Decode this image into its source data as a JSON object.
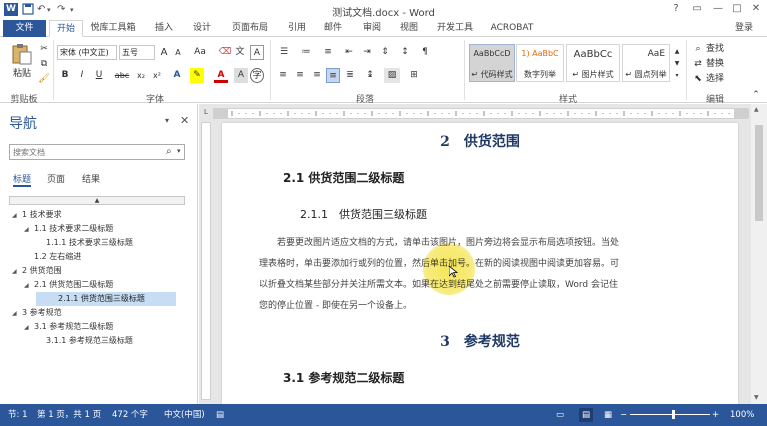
{
  "window": {
    "title": "测试文档.docx - Word",
    "app_icon": "W",
    "controls": [
      "?",
      "▭",
      "—",
      "□",
      "✕"
    ]
  },
  "qat": {
    "save_icon": "save-icon",
    "undo": "↶",
    "redo": "↷"
  },
  "tabs": [
    {
      "label": "文件",
      "active": false
    },
    {
      "label": "开始",
      "active": true
    },
    {
      "label": "悦库工具箱",
      "active": false
    },
    {
      "label": "插入",
      "active": false
    },
    {
      "label": "设计",
      "active": false
    },
    {
      "label": "页面布局",
      "active": false
    },
    {
      "label": "引用",
      "active": false
    },
    {
      "label": "邮件",
      "active": false
    },
    {
      "label": "审阅",
      "active": false
    },
    {
      "label": "视图",
      "active": false
    },
    {
      "label": "开发工具",
      "active": false
    },
    {
      "label": "ACROBAT",
      "active": false
    }
  ],
  "login": "登录",
  "ribbon": {
    "clipboard": {
      "paste": "粘贴",
      "label": "剪贴板"
    },
    "font": {
      "name": "宋体 (中文正)",
      "size": "五号",
      "label": "字体",
      "buttons": [
        "B",
        "I",
        "U",
        "abc",
        "x₂",
        "x²"
      ],
      "grow": "A",
      "shrink": "A",
      "aa": "Aa"
    },
    "paragraph": {
      "label": "段落"
    },
    "styles": {
      "label": "样式",
      "items": [
        {
          "preview": "AaBbCcD",
          "name": "↵ 代码样式"
        },
        {
          "preview": "1) AaBbC",
          "name": "数字列举"
        },
        {
          "preview": "AaBbCc",
          "name": "↵ 图片样式"
        },
        {
          "preview": "AaE",
          "name": "↵ 圆点列举"
        }
      ]
    },
    "editing": {
      "label": "编辑",
      "find": "查找",
      "replace": "替换",
      "select": "选择"
    }
  },
  "nav": {
    "title": "导航",
    "search_placeholder": "搜索文档",
    "tabs": [
      "标题",
      "页面",
      "结果"
    ],
    "tree": [
      {
        "level": 1,
        "text": "1 技术要求",
        "expanded": true,
        "selected": false
      },
      {
        "level": 2,
        "text": "1.1 技术要求二级标题",
        "expanded": true,
        "selected": false
      },
      {
        "level": 3,
        "text": "1.1.1 技术要求三级标题",
        "expanded": false,
        "selected": false
      },
      {
        "level": 2,
        "text": "1.2 左右缩进",
        "expanded": false,
        "selected": false
      },
      {
        "level": 1,
        "text": "2 供货范围",
        "expanded": true,
        "selected": false
      },
      {
        "level": 2,
        "text": "2.1 供货范围二级标题",
        "expanded": true,
        "selected": false
      },
      {
        "level": 3,
        "text": "2.1.1 供货范围三级标题",
        "expanded": false,
        "selected": true
      },
      {
        "level": 1,
        "text": "3 参考规范",
        "expanded": true,
        "selected": false
      },
      {
        "level": 2,
        "text": "3.1 参考规范二级标题",
        "expanded": true,
        "selected": false
      },
      {
        "level": 3,
        "text": "3.1.1 参考规范三级标题",
        "expanded": false,
        "selected": false
      }
    ]
  },
  "document": {
    "h1_a": "2　供货范围",
    "h2_a": "2.1 供货范围二级标题",
    "h3_a": "2.1.1　供货范围三级标题",
    "para_lines": [
      "若要更改图片适应文档的方式，请单击该图片，图片旁边将会显示布局选项按钮。当处",
      "理表格时，单击要添加行或列的位置，然后单击加号。在新的阅读视图中阅读更加容易。可",
      "以折叠文档某些部分并关注所需文本。如果在达到结尾处之前需要停止读取，Word 会记住",
      "您的停止位置 - 即使在另一个设备上。"
    ],
    "h1_b": "3　参考规范",
    "h2_b": "3.1 参考规范二级标题"
  },
  "status": {
    "section": "节: 1",
    "page": "第 1 页，共 1 页",
    "words": "472 个字",
    "language": "中文(中国)",
    "zoom": "100%",
    "zoom_level": 1.0
  },
  "colors": {
    "accent": "#2b579a",
    "heading": "#1f3864",
    "highlight": "#f5e450"
  }
}
